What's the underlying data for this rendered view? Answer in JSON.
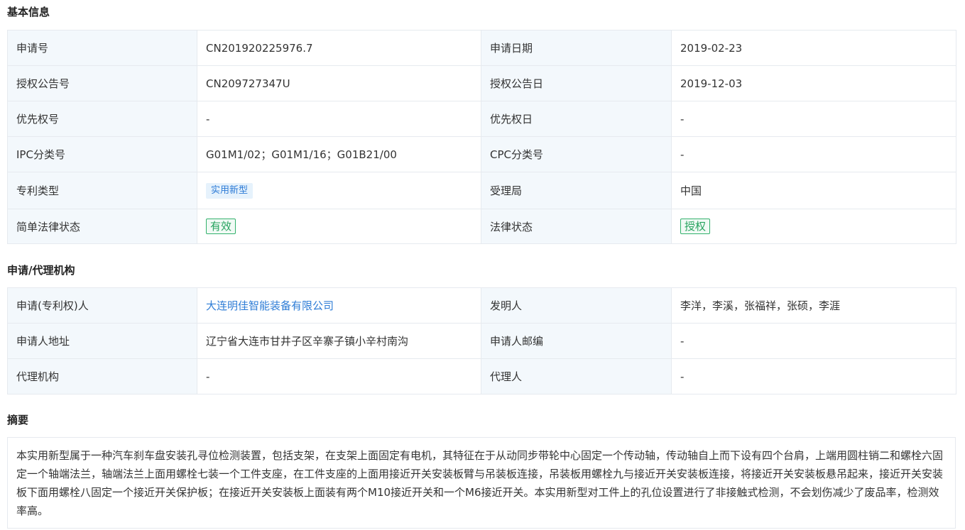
{
  "basic_info": {
    "title": "基本信息",
    "rows": [
      [
        {
          "label": "申请号",
          "value": "CN201920225976.7"
        },
        {
          "label": "申请日期",
          "value": "2019-02-23"
        }
      ],
      [
        {
          "label": "授权公告号",
          "value": "CN209727347U"
        },
        {
          "label": "授权公告日",
          "value": "2019-12-03"
        }
      ],
      [
        {
          "label": "优先权号",
          "value": "-"
        },
        {
          "label": "优先权日",
          "value": "-"
        }
      ],
      [
        {
          "label": "IPC分类号",
          "value": "G01M1/02；G01M1/16；G01B21/00"
        },
        {
          "label": "CPC分类号",
          "value": "-"
        }
      ],
      [
        {
          "label": "专利类型",
          "value": "实用新型"
        },
        {
          "label": "受理局",
          "value": "中国"
        }
      ],
      [
        {
          "label": "简单法律状态",
          "value": "有效"
        },
        {
          "label": "法律状态",
          "value": "授权"
        }
      ]
    ]
  },
  "agency_info": {
    "title": "申请/代理机构",
    "rows": [
      [
        {
          "label": "申请(专利权)人",
          "value": "大连明佳智能装备有限公司"
        },
        {
          "label": "发明人",
          "value": "李洋，李溪，张福祥，张硕，李涯"
        }
      ],
      [
        {
          "label": "申请人地址",
          "value": "辽宁省大连市甘井子区辛寨子镇小辛村南沟"
        },
        {
          "label": "申请人邮编",
          "value": "-"
        }
      ],
      [
        {
          "label": "代理机构",
          "value": "-"
        },
        {
          "label": "代理人",
          "value": "-"
        }
      ]
    ]
  },
  "abstract": {
    "title": "摘要",
    "text": "本实用新型属于一种汽车刹车盘安装孔寻位检测装置，包括支架，在支架上面固定有电机，其特征在于从动同步带轮中心固定一个传动轴，传动轴自上而下设有四个台肩，上端用圆柱销二和螺栓六固定一个轴端法兰，轴端法兰上面用螺栓七装一个工件支座，在工件支座的上面用接近开关安装板臂与吊装板连接，吊装板用螺栓九与接近开关安装板连接，将接近开关安装板悬吊起来，接近开关安装板下面用螺栓八固定一个接近开关保护板；在接近开关安装板上面装有两个M10接近开关和一个M6接近开关。本实用新型对工件上的孔位设置进行了非接触式检测，不会划伤减少了废品率，检测效率高。"
  },
  "colors": {
    "label_bg": "#f3f8fc",
    "border": "#e6eaef",
    "link": "#2f7dd6",
    "valid_green": "#27a35f",
    "type_tag_blue": "#2d7bd6"
  }
}
